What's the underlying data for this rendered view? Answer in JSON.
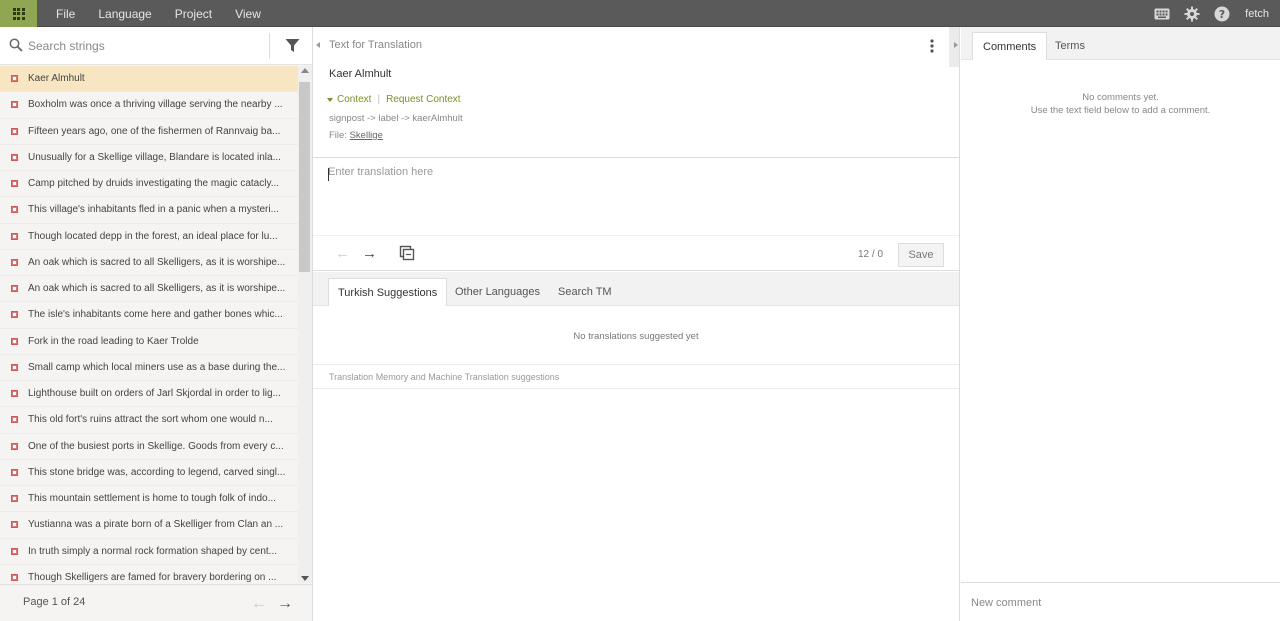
{
  "menu": {
    "items": [
      "File",
      "Language",
      "Project",
      "View"
    ]
  },
  "header_right": {
    "icons": [
      "keyboard-icon",
      "gear-icon",
      "help-icon"
    ],
    "user": "fetch"
  },
  "search": {
    "placeholder": "Search strings"
  },
  "strings": [
    "Kaer Almhult",
    "Boxholm was once a thriving village serving the nearby ...",
    "Fifteen years ago, one of the fishermen of Rannvaig ba...",
    "Unusually for a Skellige village, Blandare is located inla...",
    "Camp pitched by druids investigating the magic catacly...",
    "This village's inhabitants fled in a panic when a mysteri...",
    "Though located depp in the forest, an ideal place for lu...",
    "An oak which is sacred to all Skelligers, as it is worshipe...",
    "An oak which is sacred to all Skelligers, as it is worshipe...",
    "The isle's inhabitants come here and gather bones whic...",
    "Fork in the road leading to Kaer Trolde",
    "Small camp which local miners use as a base during the...",
    "Lighthouse built on orders of Jarl Skjordal in order to lig...",
    "This old fort's ruins attract the sort whom one would n...",
    "One of the busiest ports in Skellige. Goods from every c...",
    "This stone bridge was, according to legend, carved singl...",
    "This mountain settlement is home to tough folk of indo...",
    "Yustianna was a pirate born of a Skelliger from Clan an ...",
    "In truth simply a normal rock formation shaped by cent...",
    "Though Skelligers are famed for bravery bordering on ..."
  ],
  "pager": {
    "label": "Page 1 of 24"
  },
  "source": {
    "header": "Text for Translation",
    "text": "Kaer Almhult",
    "context_label": "Context",
    "request_context_label": "Request Context",
    "key_path": "signpost -> label -> kaerAlmhult",
    "file_label": "File:",
    "file_name": "Skellige"
  },
  "editor": {
    "placeholder": "Enter translation here",
    "char_count": "12 / 0",
    "save_label": "Save"
  },
  "suggestions": {
    "tabs": [
      "Turkish Suggestions",
      "Other Languages",
      "Search TM"
    ],
    "empty_text": "No translations suggested yet",
    "note": "Translation Memory and Machine Translation suggestions"
  },
  "comments": {
    "tabs": [
      "Comments",
      "Terms"
    ],
    "empty_line1": "No comments yet.",
    "empty_line2": "Use the text field below to add a comment.",
    "input_placeholder": "New comment"
  },
  "colors": {
    "accent": "#8fa653",
    "context_link": "#7a8f2c",
    "untranslated_status": "#e07a7a",
    "selected_row": "#f7e6c1",
    "topbar": "#5a5a5a"
  }
}
